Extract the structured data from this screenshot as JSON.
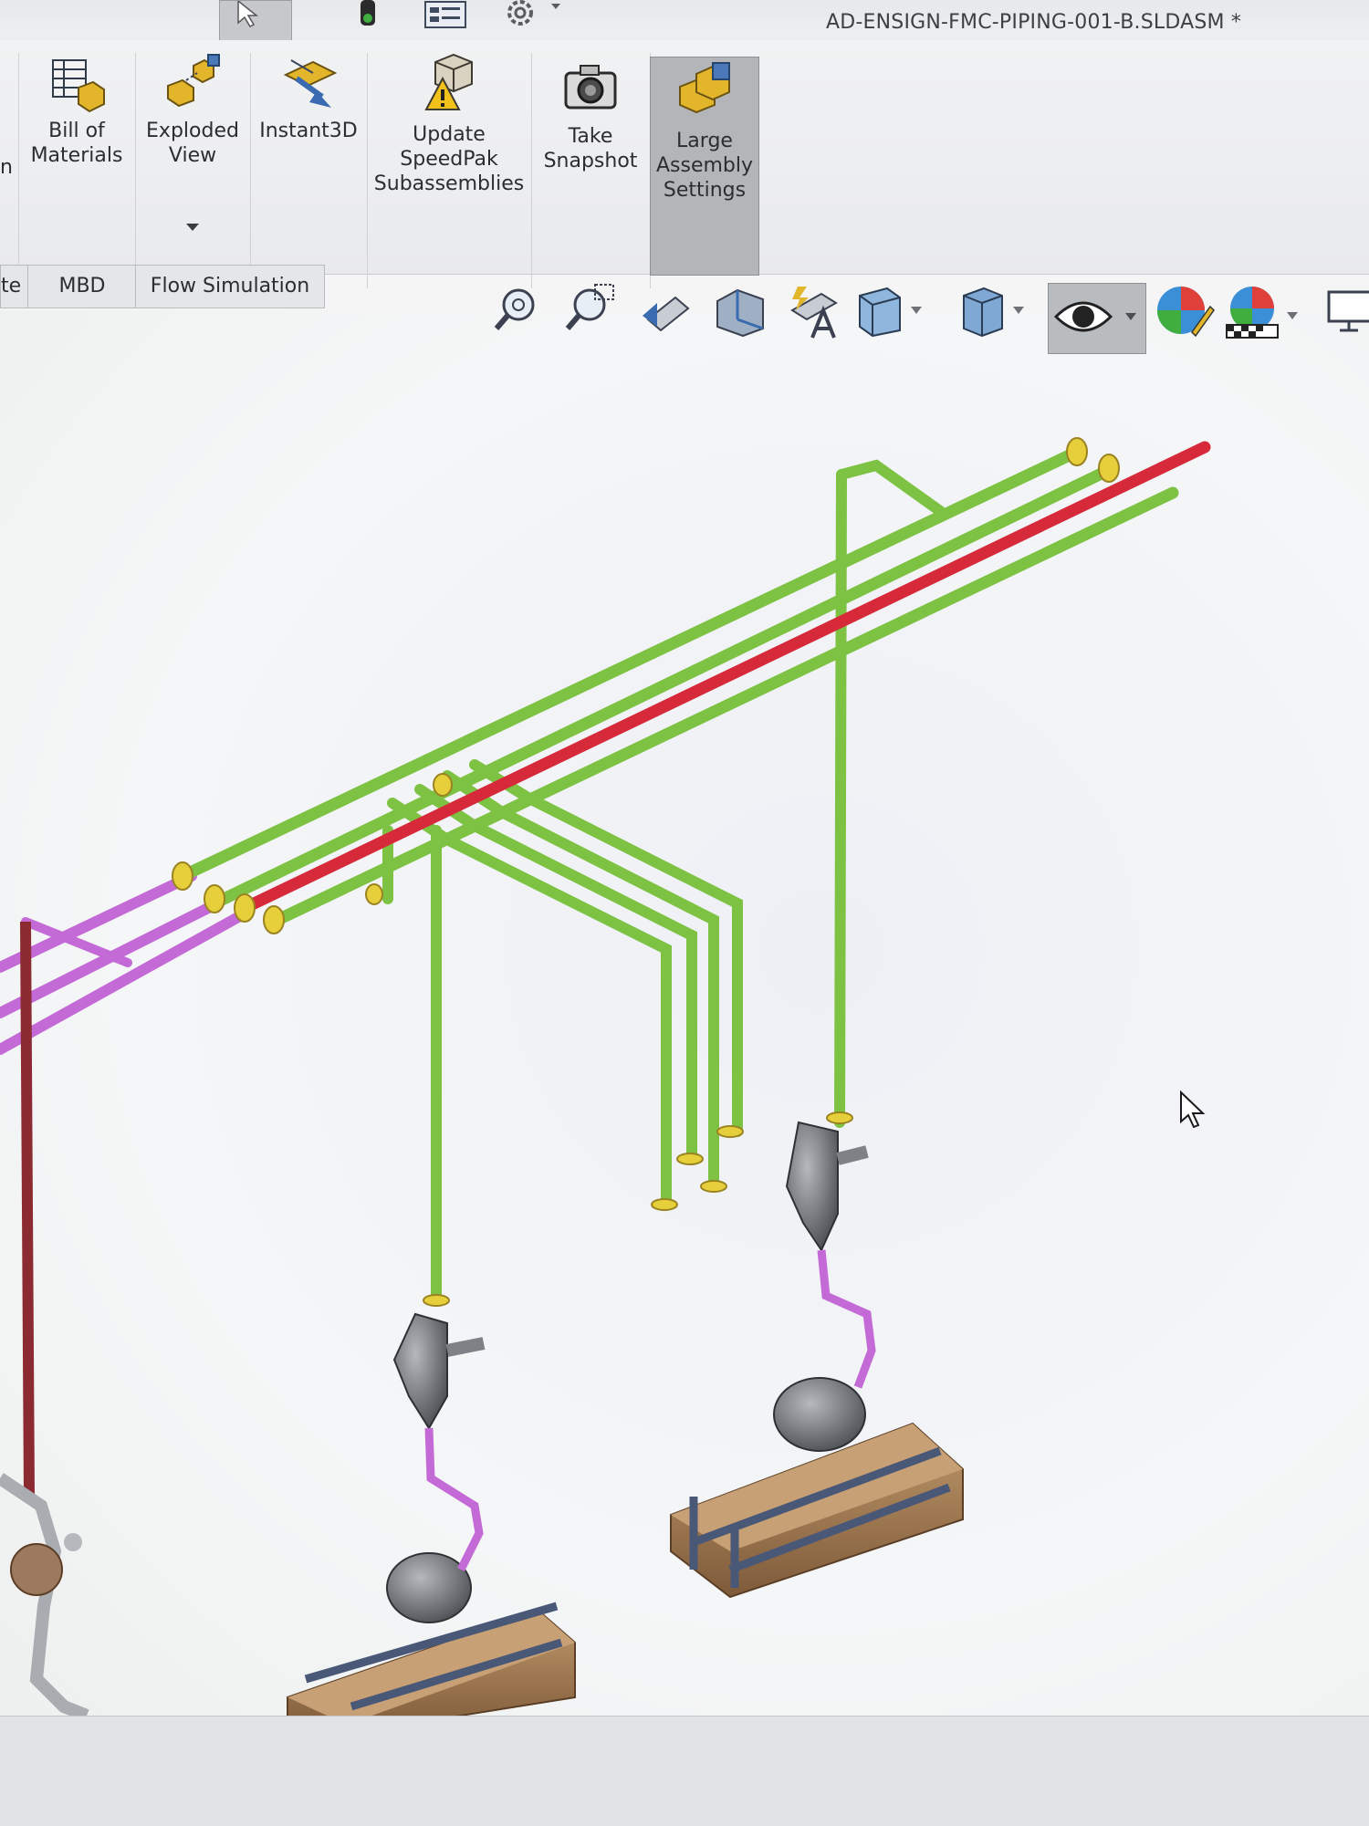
{
  "window": {
    "title": "AD-ENSIGN-FMC-PIPING-001-B.SLDASM *"
  },
  "ribbon": {
    "items": [
      {
        "label": "Bill of\nMaterials",
        "icon": "bill-of-materials-icon"
      },
      {
        "label": "Exploded\nView",
        "icon": "exploded-view-icon"
      },
      {
        "label": "Instant3D",
        "icon": "instant3d-icon"
      },
      {
        "label": "Update\nSpeedPak\nSubassemblies",
        "icon": "speedpak-icon"
      },
      {
        "label": "Take\nSnapshot",
        "icon": "camera-icon"
      },
      {
        "label": "Large\nAssembly\nSettings",
        "icon": "large-assembly-icon"
      }
    ],
    "partial_left_label": "n"
  },
  "tabs": [
    {
      "label": "te"
    },
    {
      "label": "MBD"
    },
    {
      "label": "Flow Simulation"
    }
  ],
  "heads_up_toolbar": [
    "zoom-to-fit-icon",
    "zoom-to-area-icon",
    "previous-view-icon",
    "section-view-icon",
    "dynamic-annotation-views-icon",
    "view-orientation-icon",
    "display-style-icon",
    "hide-show-items-icon",
    "edit-appearance-icon",
    "apply-scene-icon",
    "view-settings-icon"
  ],
  "colors": {
    "pipe_green": "#7dc242",
    "pipe_red": "#d62a3a",
    "pipe_magenta": "#c36ad6",
    "pipe_dark_red": "#8b2a30",
    "flange_yellow": "#e6cf3a",
    "base_wood": "#a9825a",
    "frame_blue": "#4a5878",
    "pump_grey": "#8a8d92",
    "ribbon_active": "#b3b5b8"
  }
}
